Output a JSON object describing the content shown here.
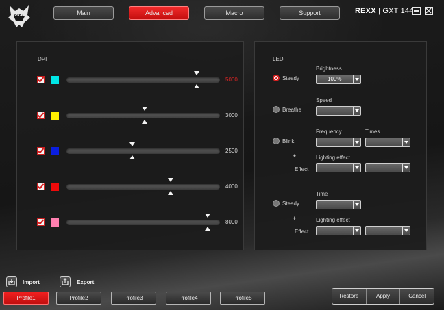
{
  "nav": {
    "tabs": [
      {
        "label": "Main",
        "active": false
      },
      {
        "label": "Advanced",
        "active": true
      },
      {
        "label": "Macro",
        "active": false
      },
      {
        "label": "Support",
        "active": false
      }
    ]
  },
  "device": {
    "name": "REXX",
    "separator": "|",
    "model": "GXT 144"
  },
  "brand": {
    "logo_text": "GXT"
  },
  "dpi": {
    "title": "DPI",
    "rows": [
      {
        "enabled": true,
        "color": "#00e5e5",
        "value": "5000",
        "slider_fraction": 0.85,
        "highlighted": true
      },
      {
        "enabled": true,
        "color": "#ffee00",
        "value": "3000",
        "slider_fraction": 0.51,
        "highlighted": false
      },
      {
        "enabled": true,
        "color": "#0a1ee0",
        "value": "2500",
        "slider_fraction": 0.43,
        "highlighted": false
      },
      {
        "enabled": true,
        "color": "#ee0a0a",
        "value": "4000",
        "slider_fraction": 0.68,
        "highlighted": false
      },
      {
        "enabled": true,
        "color": "#ff80b0",
        "value": "8000",
        "slider_fraction": 0.92,
        "highlighted": false
      }
    ]
  },
  "led": {
    "title": "LED",
    "steady": {
      "label": "Steady",
      "selected": true,
      "brightness_label": "Brightness",
      "brightness_value": "100%"
    },
    "breathe": {
      "label": "Breathe",
      "selected": false,
      "speed_label": "Speed",
      "speed_value": ""
    },
    "blink": {
      "label": "Blink",
      "selected": false,
      "frequency_label": "Frequency",
      "times_label": "Times",
      "plus": "+",
      "effect_label": "Effect",
      "lighting_effect_label": "Lighting effect"
    },
    "steady_timed": {
      "label": "Steady",
      "selected": false,
      "time_label": "Time",
      "plus": "+",
      "effect_label": "Effect",
      "lighting_effect_label": "Lighting effect"
    }
  },
  "io": {
    "import_label": "Import",
    "export_label": "Export"
  },
  "profiles": [
    {
      "label": "Profile1",
      "active": true
    },
    {
      "label": "Profile2",
      "active": false
    },
    {
      "label": "Profile3",
      "active": false
    },
    {
      "label": "Profile4",
      "active": false
    },
    {
      "label": "Profile5",
      "active": false
    }
  ],
  "actions": {
    "restore": "Restore",
    "apply": "Apply",
    "cancel": "Cancel"
  }
}
